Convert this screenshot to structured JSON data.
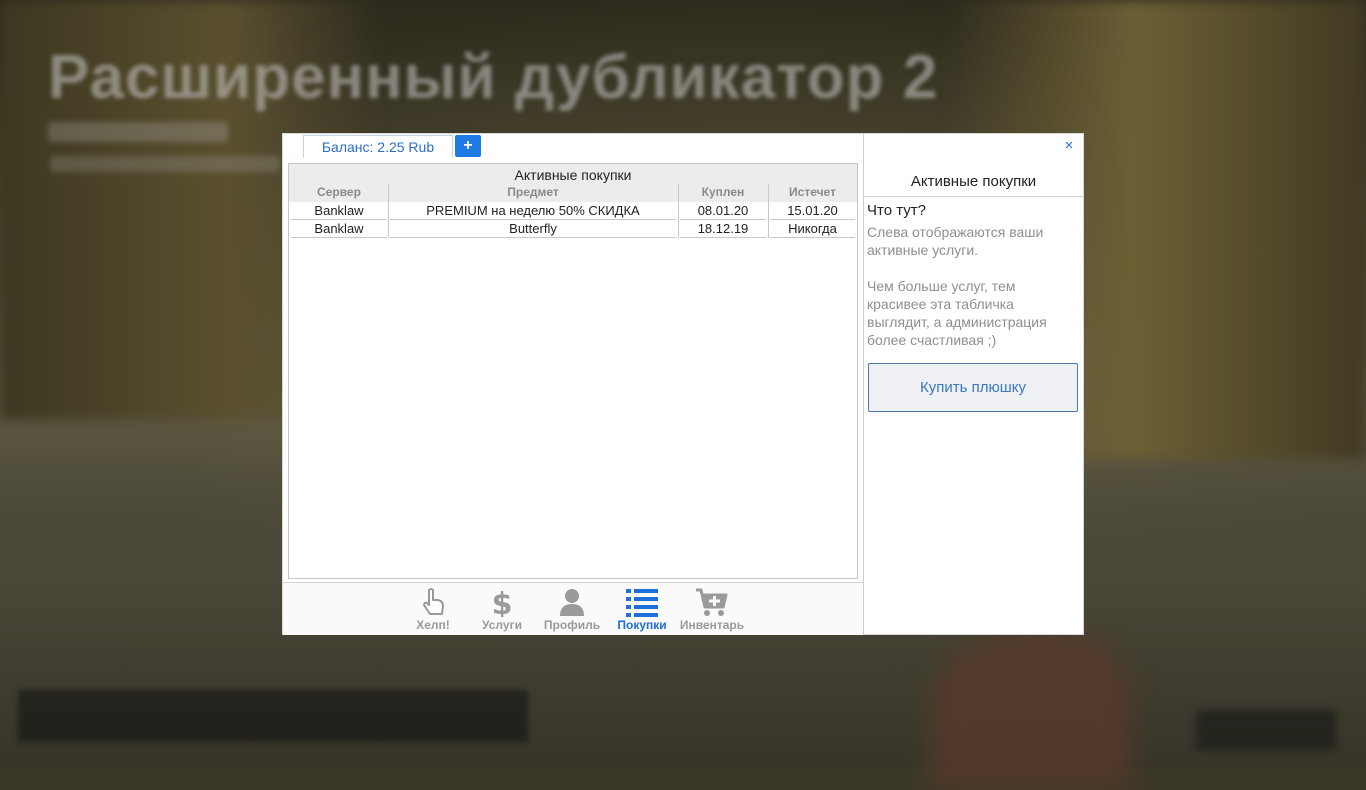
{
  "background": {
    "title": "Расширенный дубликатор 2"
  },
  "window": {
    "balance_tab": "Баланс: 2.25 Rub",
    "add_balance": "+",
    "close": "×"
  },
  "table": {
    "caption": "Активные покупки",
    "columns": [
      "Сервер",
      "Предмет",
      "Куплен",
      "Истечет"
    ],
    "rows": [
      {
        "server": "Banklaw",
        "item": "PREMIUM на неделю 50% СКИДКА",
        "bought": "08.01.20",
        "expires": "15.01.20"
      },
      {
        "server": "Banklaw",
        "item": "Butterfly",
        "bought": "18.12.19",
        "expires": "Никогда"
      }
    ]
  },
  "nav": [
    {
      "label": "Хелп!",
      "icon": "hand-pointer-icon",
      "active": false
    },
    {
      "label": "Услуги",
      "icon": "dollar-icon",
      "active": false
    },
    {
      "label": "Профиль",
      "icon": "user-icon",
      "active": false
    },
    {
      "label": "Покупки",
      "icon": "list-icon",
      "active": true
    },
    {
      "label": "Инвентарь",
      "icon": "cart-plus-icon",
      "active": false
    }
  ],
  "sidebar": {
    "title": "Активные покупки",
    "question": "Что тут?",
    "para1": "Слева отображаются ваши активные услуги.",
    "para2": "Чем больше услуг, тем красивее эта табличка выглядит, а администрация более счастливая ;)",
    "button": "Купить плюшку"
  },
  "colors": {
    "accent": "#1e7be6",
    "active_nav": "#1e6fd9",
    "inactive_nav": "#9a9a9a"
  }
}
